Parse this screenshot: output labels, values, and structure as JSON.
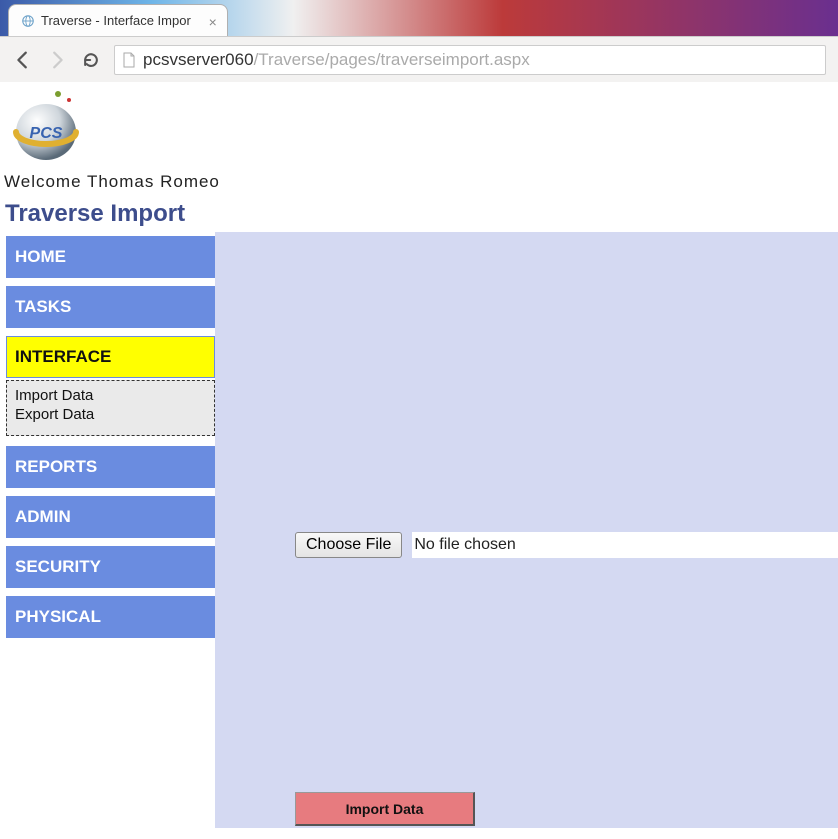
{
  "browser": {
    "tab_title": "Traverse - Interface Impor",
    "url_host": "pcsvserver060",
    "url_path": "/Traverse/pages/traverseimport.aspx"
  },
  "header": {
    "welcome": "Welcome Thomas Romeo",
    "page_title": "Traverse Import"
  },
  "sidebar": {
    "items": [
      {
        "label": "HOME"
      },
      {
        "label": "TASKS"
      },
      {
        "label": "INTERFACE",
        "active": true
      },
      {
        "label": "REPORTS"
      },
      {
        "label": "ADMIN"
      },
      {
        "label": "SECURITY"
      },
      {
        "label": "PHYSICAL"
      }
    ],
    "sub_items": [
      {
        "label": "Import Data"
      },
      {
        "label": "Export Data"
      }
    ]
  },
  "main": {
    "choose_file_label": "Choose File",
    "file_status": "No file chosen",
    "import_button": "Import Data"
  }
}
